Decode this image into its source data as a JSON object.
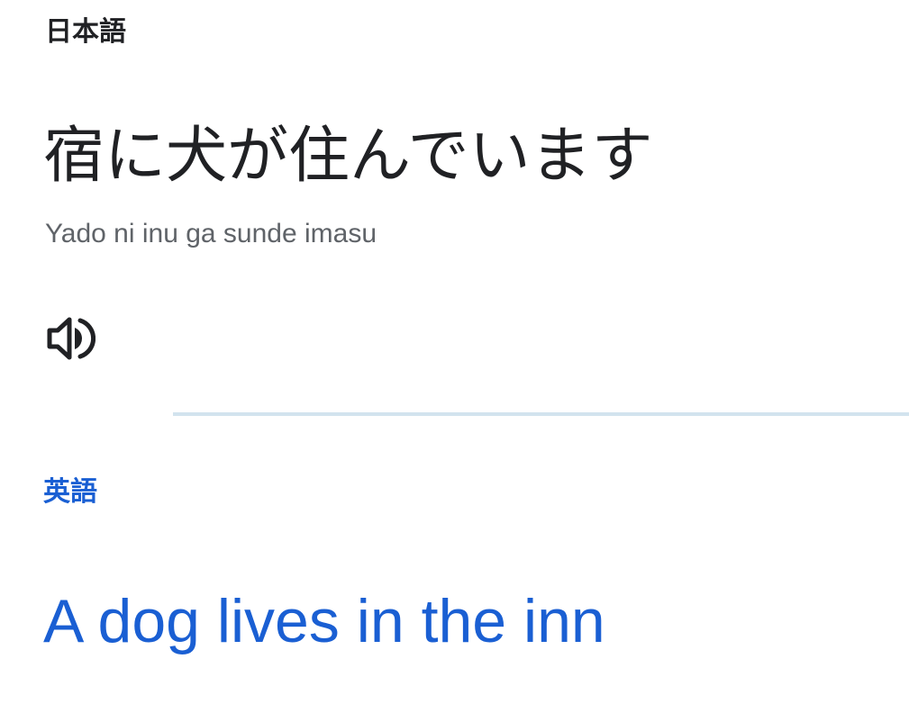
{
  "source": {
    "language": "日本語",
    "text": "宿に犬が住んでいます",
    "romanization": "Yado ni inu ga sunde imasu",
    "listen_icon": "volume-up-icon"
  },
  "target": {
    "language": "英語",
    "text": "A dog lives in the inn"
  },
  "colors": {
    "text_primary": "#202124",
    "text_secondary": "#5f6368",
    "accent_blue": "#1a5fd3",
    "divider": "#d2e3ee"
  }
}
